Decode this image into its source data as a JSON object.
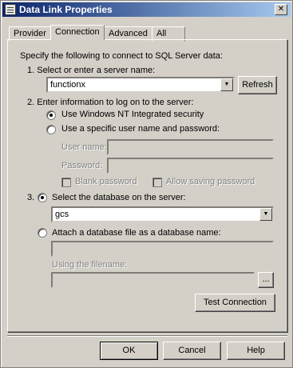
{
  "window": {
    "title": "Data Link Properties",
    "close_label": "✕"
  },
  "tabs": [
    "Provider",
    "Connection",
    "Advanced",
    "All"
  ],
  "active_tab": "Connection",
  "connection": {
    "intro": "Specify the following to connect to SQL Server data:",
    "step1": "1. Select or enter a server name:",
    "server_value": "functionx",
    "refresh": "Refresh",
    "step2": "2. Enter information to log on to the server:",
    "radio_nt": "Use Windows NT Integrated security",
    "radio_specific": "Use a specific user name and password:",
    "username_label": "User name:",
    "password_label": "Password:",
    "blank_password": "Blank password",
    "allow_saving": "Allow saving password",
    "step3_num": "3.",
    "radio_select_db": "Select the database on the server:",
    "database_value": "gcs",
    "radio_attach": "Attach a database file as a database name:",
    "using_filename": "Using the filename:",
    "browse": "...",
    "test_connection": "Test Connection"
  },
  "footer": {
    "ok": "OK",
    "cancel": "Cancel",
    "help": "Help"
  },
  "icons": {
    "dropdown": "chevron-down-icon",
    "window": "data-link-icon"
  }
}
